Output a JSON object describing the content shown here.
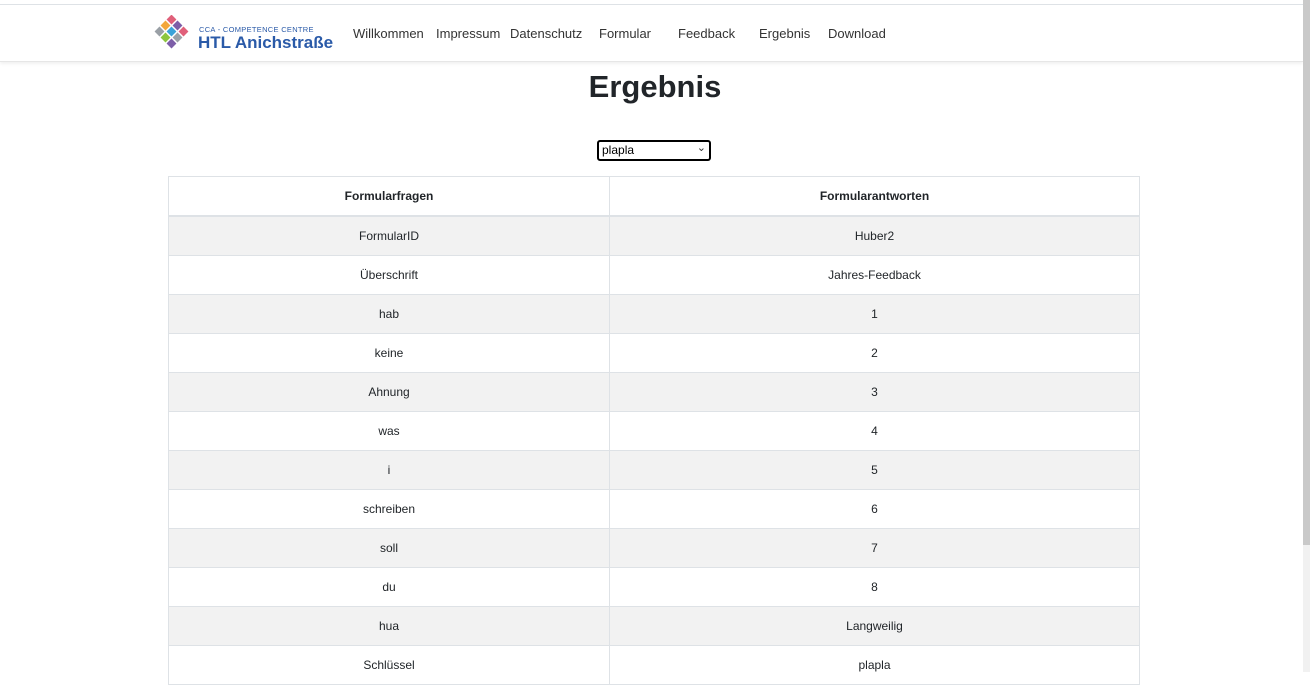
{
  "brand": {
    "small_text": "CCA - COMPETENCE CENTRE",
    "name": "HTL Anichstraße",
    "logo_colors": [
      "#e0607a",
      "#f3a63b",
      "#8dc63f",
      "#3aa3d9",
      "#7d5ea8",
      "#9aa0a6"
    ]
  },
  "nav": {
    "items": [
      "Willkommen",
      "Impressum",
      "Datenschutz",
      "Formular",
      "Feedback",
      "Ergebnis",
      "Download"
    ]
  },
  "page": {
    "title": "Ergebnis"
  },
  "selector": {
    "value": "plapla",
    "icon": "chevron-down-icon"
  },
  "table": {
    "headers": [
      "Formularfragen",
      "Formularantworten"
    ],
    "rows": [
      [
        "FormularID",
        "Huber2"
      ],
      [
        "Überschrift",
        "Jahres-Feedback"
      ],
      [
        "hab",
        "1"
      ],
      [
        "keine",
        "2"
      ],
      [
        "Ahnung",
        "3"
      ],
      [
        "was",
        "4"
      ],
      [
        "i",
        "5"
      ],
      [
        "schreiben",
        "6"
      ],
      [
        "soll",
        "7"
      ],
      [
        "du",
        "8"
      ],
      [
        "hua",
        "Langweilig"
      ],
      [
        "Schlüssel",
        "plapla"
      ]
    ]
  }
}
